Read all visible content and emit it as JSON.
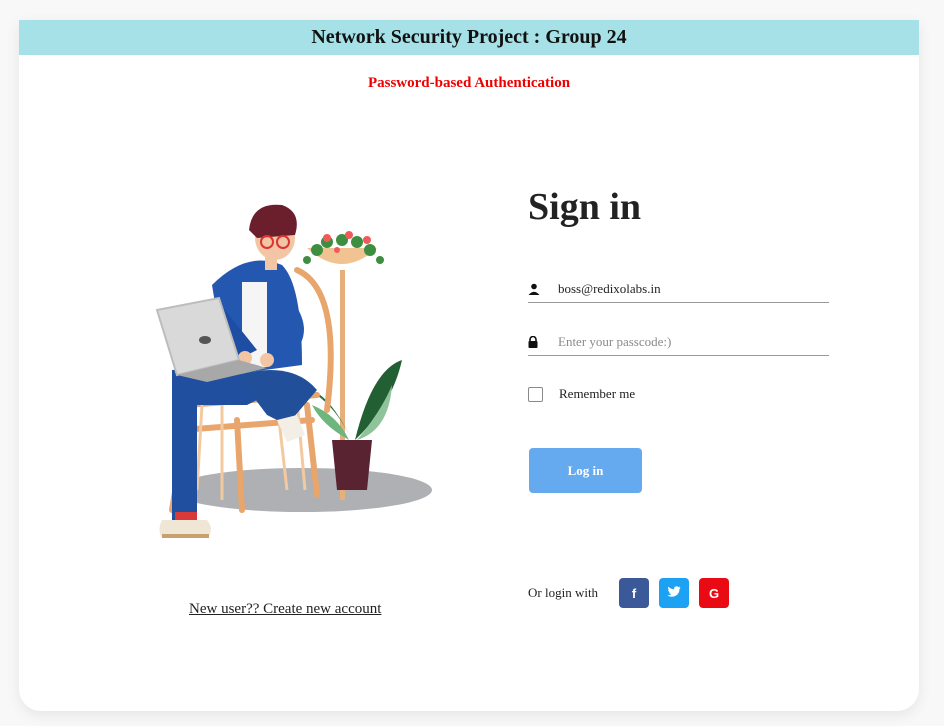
{
  "header": {
    "title": "Network Security Project : Group 24"
  },
  "subtitle": "Password-based Authentication",
  "signup": {
    "link_text": "New user?? Create new account"
  },
  "signin": {
    "title": "Sign in",
    "username": {
      "value": "boss@redixolabs.in",
      "icon": "person-icon"
    },
    "password": {
      "value": "",
      "placeholder": "Enter your passcode:)",
      "icon": "lock-icon"
    },
    "remember_label": "Remember me",
    "remember_checked": false,
    "login_label": "Log in",
    "social_label": "Or login with",
    "social": [
      {
        "name": "facebook",
        "glyph": "f",
        "color": "#3b5998"
      },
      {
        "name": "twitter",
        "glyph": "t",
        "color": "#1da1f2"
      },
      {
        "name": "google",
        "glyph": "G",
        "color": "#ea0a14"
      }
    ]
  },
  "colors": {
    "banner": "#a5e1e7",
    "subtitle": "#ee0000",
    "login_button": "#65aaee"
  },
  "illustration": "person-with-laptop-on-chair-illustration"
}
